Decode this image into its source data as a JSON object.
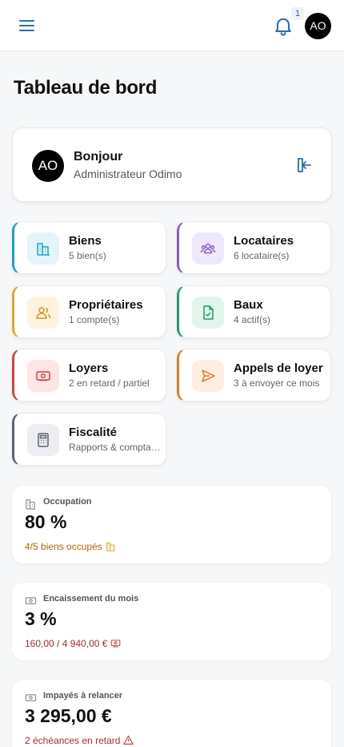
{
  "header": {
    "notification_count": "1",
    "avatar_initials": "AO"
  },
  "page": {
    "title": "Tableau de bord"
  },
  "welcome": {
    "avatar_initials": "AO",
    "greeting": "Bonjour",
    "role": "Administrateur Odimo"
  },
  "tiles": [
    {
      "title": "Biens",
      "subtitle": "5 bien(s)",
      "accent": "#1aa3c9",
      "icon_bg": "#e3f4fb",
      "icon_color": "#1aa3c9",
      "icon": "building-icon"
    },
    {
      "title": "Locataires",
      "subtitle": "6 locataire(s)",
      "accent": "#8b5cc9",
      "icon_bg": "#efe8fb",
      "icon_color": "#8b5cc9",
      "icon": "users-icon"
    },
    {
      "title": "Propriétaires",
      "subtitle": "1 compte(s)",
      "accent": "#e0a82a",
      "icon_bg": "#fdf3df",
      "icon_color": "#d6981c",
      "icon": "owners-icon"
    },
    {
      "title": "Baux",
      "subtitle": "4 actif(s)",
      "accent": "#1f9d6a",
      "icon_bg": "#e1f5ec",
      "icon_color": "#1f9d6a",
      "icon": "document-check-icon"
    },
    {
      "title": "Loyers",
      "subtitle": "2 en retard / partiel",
      "accent": "#d9413f",
      "icon_bg": "#fbe5e5",
      "icon_color": "#d9413f",
      "icon": "money-icon"
    },
    {
      "title": "Appels de loyer",
      "subtitle": "3 à envoyer ce mois",
      "accent": "#e07b24",
      "icon_bg": "#fdeee1",
      "icon_color": "#e07b24",
      "icon": "send-icon"
    },
    {
      "title": "Fiscalité",
      "subtitle": "Rapports & comptabilité",
      "accent": "#5b6472",
      "icon_bg": "#eceef1",
      "icon_color": "#5b6472",
      "icon": "calculator-icon"
    }
  ],
  "stats": [
    {
      "label": "Occupation",
      "value": "80 %",
      "note": "4/5 biens occupés",
      "note_color": "#b8690a",
      "icon": "building-icon",
      "note_icon": "building-icon"
    },
    {
      "label": "Encaissement du mois",
      "value": "3 %",
      "note": "160,00 / 4 940,00 €",
      "note_color": "#c0262d",
      "icon": "money-icon",
      "note_icon": "money-icon"
    },
    {
      "label": "Impayés à relancer",
      "value": "3 295,00 €",
      "note": "2 échéances en retard",
      "note_color": "#c0262d",
      "icon": "money-icon",
      "note_icon": "warning-icon"
    }
  ]
}
